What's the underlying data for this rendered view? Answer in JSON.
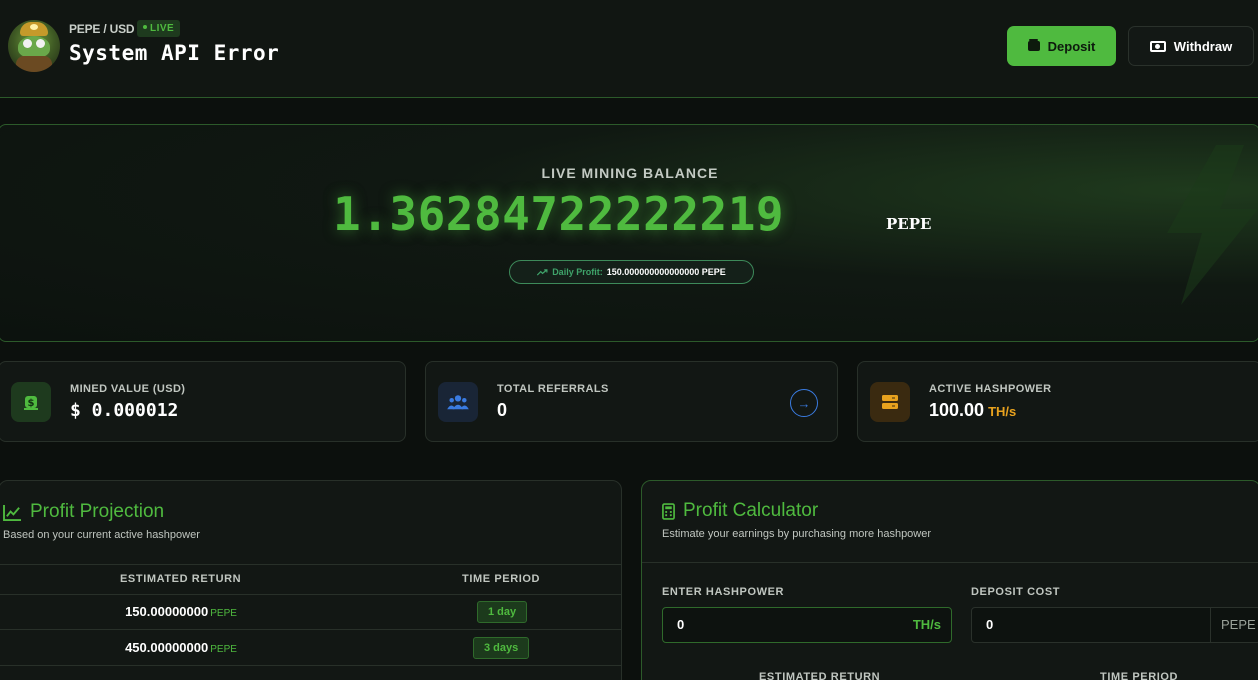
{
  "header": {
    "pair": "PEPE / USD",
    "live_badge": "LIVE",
    "title": "System API Error",
    "deposit_label": "Deposit",
    "withdraw_label": "Withdraw"
  },
  "balance": {
    "label": "LIVE MINING BALANCE",
    "value": "1.36284722222219",
    "unit": "PEPE",
    "daily_profit_label": "Daily Profit:",
    "daily_profit_value": "150.000000000000000 PEPE"
  },
  "stats": {
    "mined": {
      "label": "MINED VALUE (USD)",
      "value": "$ 0.000012"
    },
    "referrals": {
      "label": "TOTAL REFERRALS",
      "value": "0"
    },
    "hashpower": {
      "label": "ACTIVE HASHPOWER",
      "value": "100.00",
      "unit": "TH/s"
    }
  },
  "projection": {
    "title": "Profit Projection",
    "subtitle": "Based on your current active hashpower",
    "col_return": "ESTIMATED RETURN",
    "col_period": "TIME PERIOD",
    "rows": [
      {
        "value": "150.00000000",
        "unit": "PEPE",
        "period": "1 day"
      },
      {
        "value": "450.00000000",
        "unit": "PEPE",
        "period": "3 days"
      }
    ]
  },
  "calculator": {
    "title": "Profit Calculator",
    "subtitle": "Estimate your earnings by purchasing more hashpower",
    "hashpower_label": "ENTER HASHPOWER",
    "hashpower_value": "0",
    "hashpower_unit": "TH/s",
    "cost_label": "DEPOSIT COST",
    "cost_value": "0",
    "cost_unit": "PEPE",
    "col_return": "ESTIMATED RETURN",
    "col_period": "TIME PERIOD"
  },
  "colors": {
    "accent": "#4fba3f",
    "background": "#0c100d",
    "hashpower_unit": "#e8a21e",
    "referral_accent": "#3a7be0"
  },
  "icons": [
    "pepe-miner-avatar",
    "wallet-icon",
    "cash-icon",
    "trend-up-icon",
    "money-bag-icon",
    "users-icon",
    "arrow-right-icon",
    "server-icon",
    "chart-line-icon",
    "calculator-icon"
  ]
}
